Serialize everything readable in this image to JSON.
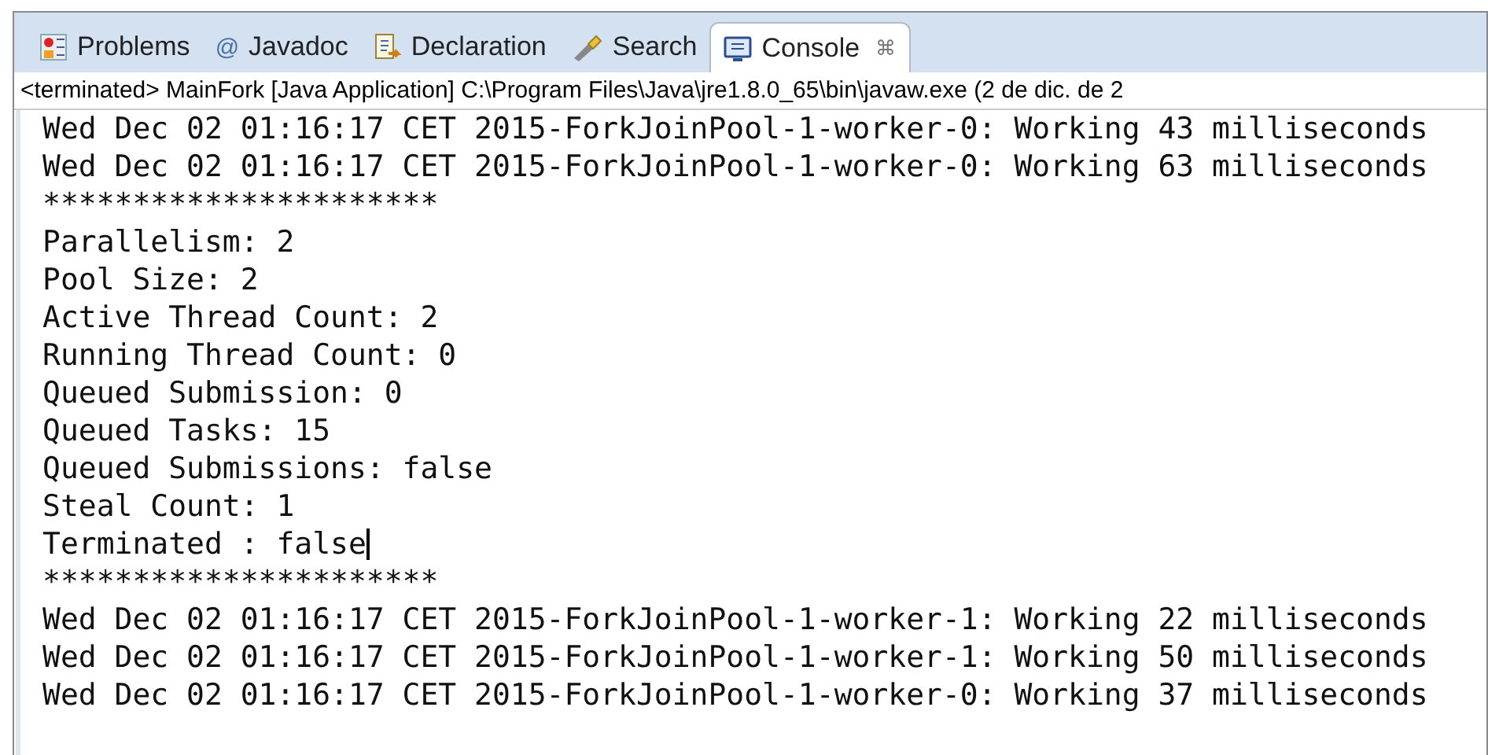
{
  "tabs": [
    {
      "label": "Problems",
      "selected": false
    },
    {
      "label": "Javadoc",
      "glyph": "@",
      "selected": false
    },
    {
      "label": "Declaration",
      "selected": false
    },
    {
      "label": "Search",
      "selected": false
    },
    {
      "label": "Console",
      "selected": true,
      "close": "⌘"
    }
  ],
  "console": {
    "header": "<terminated> MainFork [Java Application] C:\\Program Files\\Java\\jre1.8.0_65\\bin\\javaw.exe (2 de dic. de 2",
    "lines": [
      {
        "text": "Wed Dec 02 01:16:17 CET 2015-ForkJoinPool-1-worker-0: Working 43 milliseconds",
        "cursor": false
      },
      {
        "text": "Wed Dec 02 01:16:17 CET 2015-ForkJoinPool-1-worker-0: Working 63 milliseconds",
        "cursor": false
      },
      {
        "text": "**********************",
        "cursor": false
      },
      {
        "text": "Parallelism: 2",
        "cursor": false
      },
      {
        "text": "Pool Size: 2",
        "cursor": false
      },
      {
        "text": "Active Thread Count: 2",
        "cursor": false
      },
      {
        "text": "Running Thread Count: 0",
        "cursor": false
      },
      {
        "text": "Queued Submission: 0",
        "cursor": false
      },
      {
        "text": "Queued Tasks: 15",
        "cursor": false
      },
      {
        "text": "Queued Submissions: false",
        "cursor": false
      },
      {
        "text": "Steal Count: 1",
        "cursor": false
      },
      {
        "text": "Terminated : false",
        "cursor": true
      },
      {
        "text": "**********************",
        "cursor": false
      },
      {
        "text": "Wed Dec 02 01:16:17 CET 2015-ForkJoinPool-1-worker-1: Working 22 milliseconds",
        "cursor": false
      },
      {
        "text": "Wed Dec 02 01:16:17 CET 2015-ForkJoinPool-1-worker-1: Working 50 milliseconds",
        "cursor": false
      },
      {
        "text": "Wed Dec 02 01:16:17 CET 2015-ForkJoinPool-1-worker-0: Working 37 milliseconds",
        "cursor": false
      }
    ]
  }
}
